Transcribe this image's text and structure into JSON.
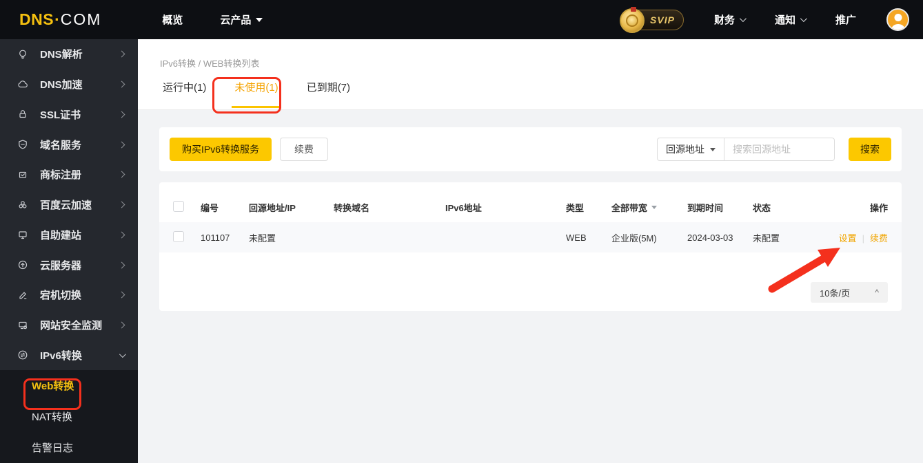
{
  "header": {
    "logo": {
      "part1": "DNS",
      "dot": "·",
      "part2": "COM"
    },
    "nav": [
      {
        "label": "概览"
      },
      {
        "label": "云产品"
      }
    ],
    "svip_label": "SVIP",
    "finance": "财务",
    "notifications": "通知",
    "promotion": "推广"
  },
  "sidebar": {
    "items": [
      {
        "label": "DNS解析",
        "icon": "bulb-icon"
      },
      {
        "label": "DNS加速",
        "icon": "cloud-icon"
      },
      {
        "label": "SSL证书",
        "icon": "lock-icon"
      },
      {
        "label": "域名服务",
        "icon": "shield-icon"
      },
      {
        "label": "商标注册",
        "icon": "mail-icon"
      },
      {
        "label": "百度云加速",
        "icon": "baidu-cloud-icon"
      },
      {
        "label": "自助建站",
        "icon": "monitor-icon"
      },
      {
        "label": "云服务器",
        "icon": "cloud-server-icon"
      },
      {
        "label": "宕机切换",
        "icon": "failover-icon"
      },
      {
        "label": "网站安全监测",
        "icon": "security-monitor-icon"
      },
      {
        "label": "IPv6转换",
        "icon": "ipv6-swap-icon",
        "expanded": true
      }
    ],
    "subitems": [
      {
        "label": "Web转换",
        "active": true
      },
      {
        "label": "NAT转换",
        "active": false
      },
      {
        "label": "告警日志",
        "active": false
      }
    ]
  },
  "main": {
    "breadcrumb": "IPv6转换 / WEB转换列表",
    "tabs": [
      {
        "label": "运行中(1)",
        "active": false
      },
      {
        "label": "未使用(1)",
        "active": true
      },
      {
        "label": "已到期(7)",
        "active": false
      }
    ],
    "toolbar": {
      "buy_button": "购买IPv6转换服务",
      "renew_button": "续费",
      "filter_select": "回源地址",
      "search_placeholder": "搜索回源地址",
      "search_button": "搜索"
    },
    "table": {
      "columns": [
        "编号",
        "回源地址/IP",
        "转换域名",
        "IPv6地址",
        "类型",
        "全部带宽",
        "到期时间",
        "状态",
        "操作"
      ],
      "rows": [
        {
          "id": "101107",
          "origin": "未配置",
          "domain": "",
          "ipv6": "",
          "type": "WEB",
          "bandwidth": "企业版(5M)",
          "expire": "2024-03-03",
          "status": "未配置",
          "action_settings": "设置",
          "action_renew": "续费"
        }
      ]
    },
    "pagination": {
      "page_size": "10条/页",
      "caret": "^"
    }
  },
  "colors": {
    "brand_yellow": "#fcc800",
    "active_tab_text": "#f5a300",
    "tab_underline": "#fbc400",
    "link_orange": "#f0a500",
    "annotation_red": "#f4301d",
    "header_bg": "#0d0f13",
    "sidebar_bg": "#25282e",
    "submenu_bg": "#16181d",
    "avatar_orange": "#f5a623",
    "row_bg": "#f8f9fb"
  }
}
